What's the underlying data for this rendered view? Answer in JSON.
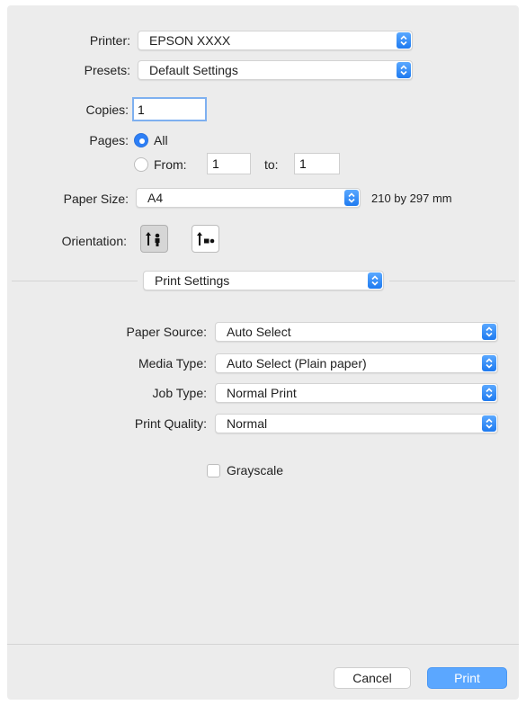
{
  "printer": {
    "label": "Printer:",
    "value": "EPSON XXXX"
  },
  "presets": {
    "label": "Presets:",
    "value": "Default Settings"
  },
  "copies": {
    "label": "Copies:",
    "value": "1"
  },
  "pages": {
    "label": "Pages:",
    "all_label": "All",
    "from_label": "From:",
    "from_value": "1",
    "to_label": "to:",
    "to_value": "1",
    "selected": "All"
  },
  "paper_size": {
    "label": "Paper Size:",
    "value": "A4",
    "dimensions": "210 by 297 mm"
  },
  "orientation": {
    "label": "Orientation:",
    "selected": "portrait"
  },
  "section": {
    "value": "Print Settings"
  },
  "settings": [
    {
      "label": "Paper Source:",
      "value": "Auto Select"
    },
    {
      "label": "Media Type:",
      "value": "Auto Select (Plain paper)"
    },
    {
      "label": "Job Type:",
      "value": "Normal Print"
    },
    {
      "label": "Print Quality:",
      "value": "Normal"
    }
  ],
  "grayscale": {
    "label": "Grayscale",
    "checked": false
  },
  "buttons": {
    "cancel": "Cancel",
    "print": "Print"
  },
  "colors": {
    "accent": "#2d7ff6",
    "print_button": "#5ba7ff",
    "dialog_bg": "#ececec"
  }
}
